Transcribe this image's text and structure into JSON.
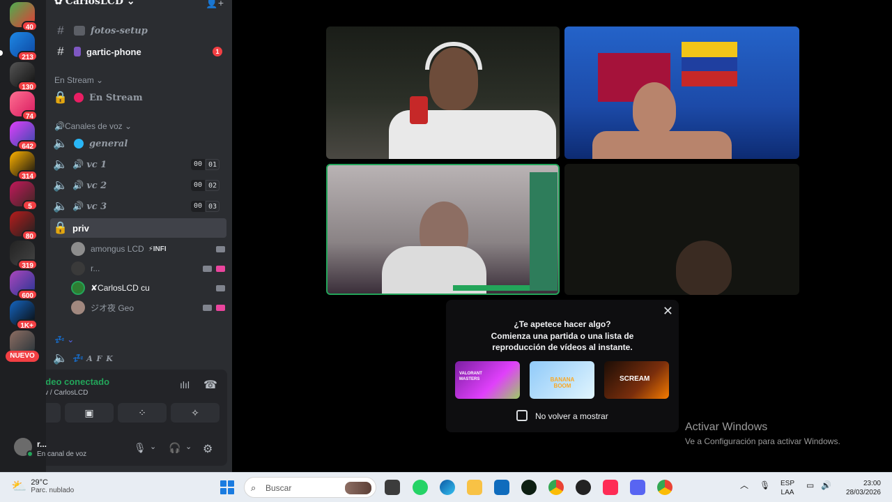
{
  "server_rail": {
    "badges": [
      "40",
      "213",
      "130",
      "74",
      "642",
      "314",
      "5",
      "80",
      "319",
      "600",
      "1K+"
    ],
    "new_label": "NUEVO"
  },
  "sidebar": {
    "server_name": "CarlosLCD",
    "channels": [
      {
        "name": "fotos-setup"
      },
      {
        "name": "gartic-phone",
        "unread": "1"
      }
    ],
    "category_stream": "En Stream",
    "stream_channel": "En Stream",
    "category_voice": "🔊Canales de voz",
    "voice_channels": [
      {
        "name": "general"
      },
      {
        "name": "vc 1",
        "count_a": "00",
        "count_b": "01"
      },
      {
        "name": "vc 2",
        "count_a": "00",
        "count_b": "02"
      },
      {
        "name": "vc 3",
        "count_a": "00",
        "count_b": "03"
      }
    ],
    "active_channel": "priv",
    "users": [
      {
        "name": "amongus LCD",
        "tag": "⚡INFI"
      },
      {
        "name": "r..."
      },
      {
        "name": "✘CarlosLCD cu"
      },
      {
        "name": "ジオ夜 Geo"
      }
    ],
    "afk_channel": "A F K"
  },
  "voice_panel": {
    "status": "Vídeo conectado",
    "location": "priv / CarlosLCD",
    "self_name": "r...",
    "self_status": "En canal de voz"
  },
  "popup": {
    "title": "¿Te apetece hacer algo?",
    "desc": "Comienza una partida o una lista de reproducción de vídeos al instante.",
    "checkbox_label": "No volver a mostrar",
    "games": [
      "VALORANT MASTERS",
      "BANANA BOOM",
      "SCREAM"
    ]
  },
  "watermark": {
    "title": "Activar Windows",
    "subtitle": "Ve a Configuración para activar Windows."
  },
  "taskbar": {
    "temp": "29°C",
    "weather": "Parc. nublado",
    "search_placeholder": "Buscar",
    "lang": "ESP",
    "lang2": "LAA",
    "time": "23:00",
    "date": "28/03/2026"
  }
}
